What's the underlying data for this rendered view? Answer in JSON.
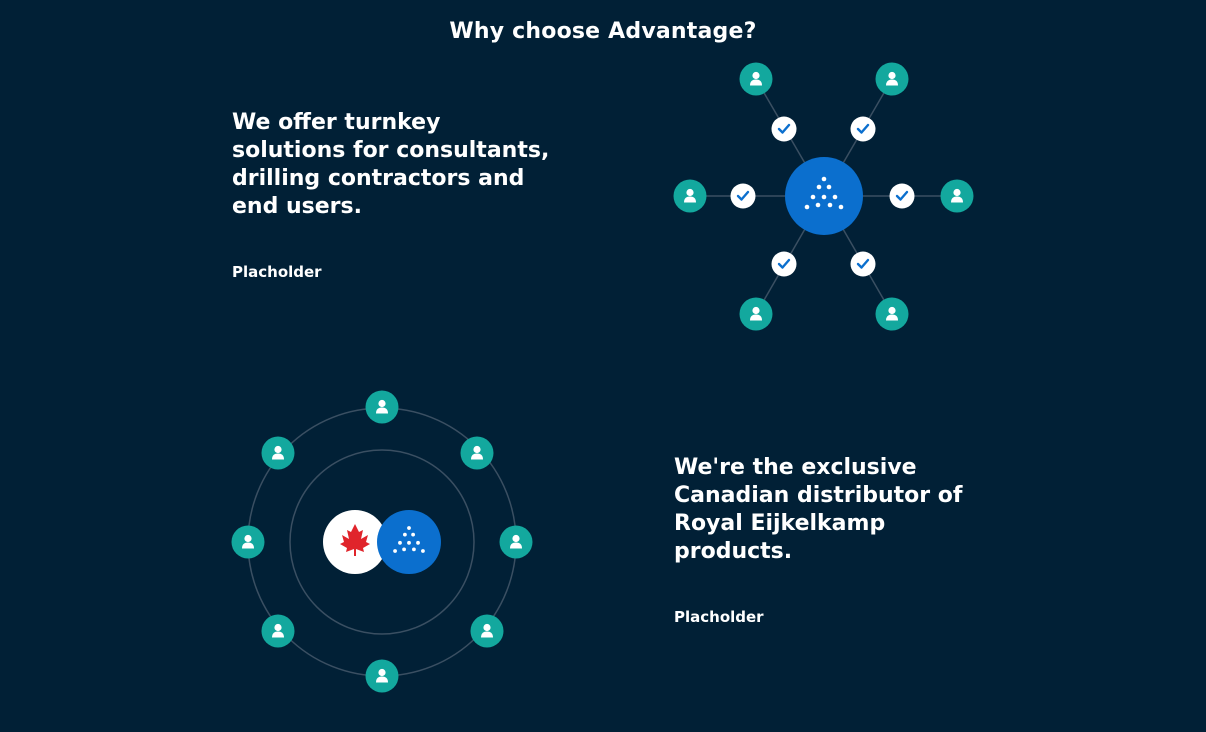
{
  "page": {
    "title": "Why choose Advantage?"
  },
  "sections": [
    {
      "heading": "We offer turnkey solutions for consultants, drilling contractors and end users.",
      "text": "Placholder"
    },
    {
      "heading": "We're the exclusive Canadian distributor of Royal Eijkelkamp products.",
      "text": "Placholder"
    }
  ],
  "colors": {
    "background": "#012036",
    "teal": "#13a89e",
    "blue": "#0b6fce",
    "ring": "#3a4f62",
    "white": "#ffffff",
    "maple_red": "#e0242b"
  },
  "icons": {
    "person": "person-icon",
    "check": "check-icon",
    "brand": "advantage-logo-icon",
    "maple": "maple-leaf-icon"
  }
}
